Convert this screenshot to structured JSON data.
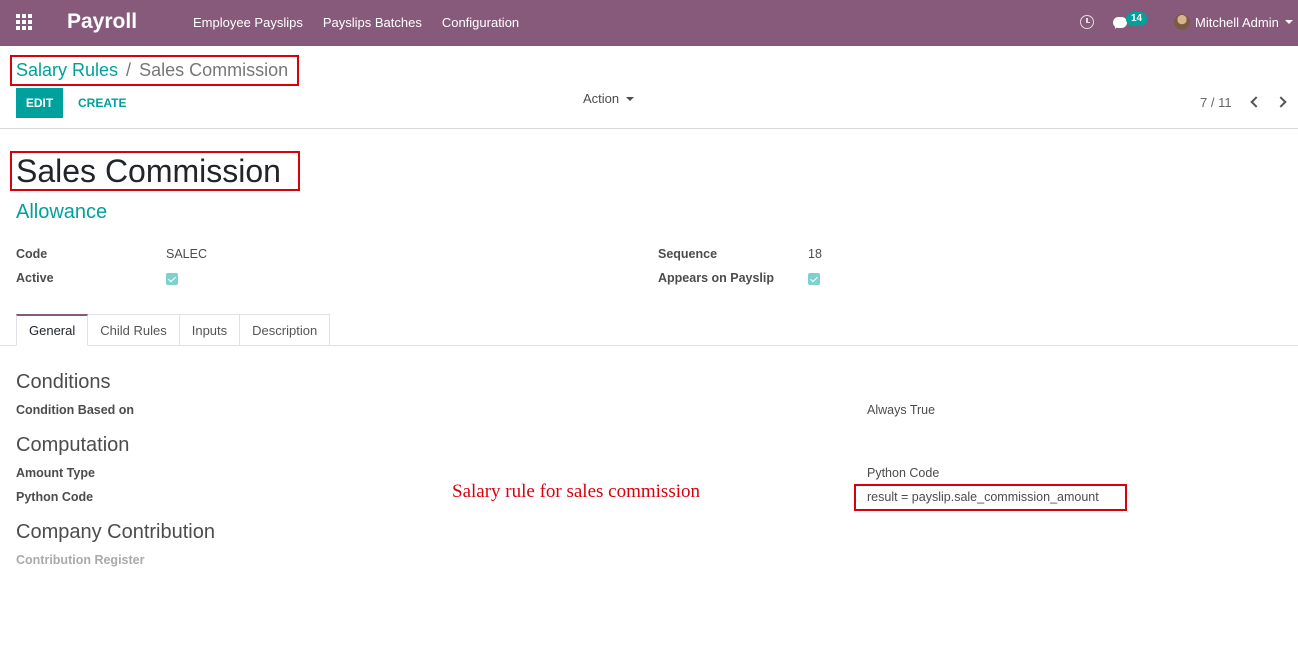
{
  "navbar": {
    "brand": "Payroll",
    "menu": [
      "Employee Payslips",
      "Payslips Batches",
      "Configuration"
    ],
    "chat_count": "14",
    "user_name": "Mitchell Admin"
  },
  "breadcrumb": {
    "parent": "Salary Rules",
    "separator": "/",
    "current": "Sales Commission"
  },
  "buttons": {
    "edit": "EDIT",
    "create": "CREATE",
    "action": "Action"
  },
  "pager": {
    "value": "7 / 11"
  },
  "record": {
    "title": "Sales Commission",
    "category": "Allowance",
    "code_label": "Code",
    "code_value": "SALEC",
    "active_label": "Active",
    "active_checked": true,
    "sequence_label": "Sequence",
    "sequence_value": "18",
    "appears_label": "Appears on Payslip",
    "appears_checked": true
  },
  "tabs": [
    "General",
    "Child Rules",
    "Inputs",
    "Description"
  ],
  "general": {
    "conditions_heading": "Conditions",
    "condition_based_label": "Condition Based on",
    "condition_based_value": "Always True",
    "computation_heading": "Computation",
    "amount_type_label": "Amount Type",
    "amount_type_value": "Python Code",
    "python_code_label": "Python Code",
    "python_code_value": "result = payslip.sale_commission_amount",
    "company_heading": "Company Contribution",
    "contribution_register_label": "Contribution Register"
  },
  "annotation": "Salary rule for sales commission",
  "colors": {
    "navbar": "#875A7B",
    "accent": "#00A09D",
    "highlight_box": "#d9000d"
  }
}
